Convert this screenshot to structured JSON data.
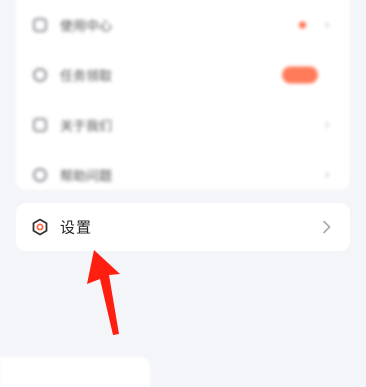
{
  "menu": {
    "items": [
      {
        "label": "使用中心",
        "icon": "grid-icon",
        "badge": "dot"
      },
      {
        "label": "任务领取",
        "icon": "gift-icon",
        "badge": "pill"
      },
      {
        "label": "关于我们",
        "icon": "info-icon",
        "badge": ""
      },
      {
        "label": "帮助问题",
        "icon": "help-icon",
        "badge": ""
      }
    ]
  },
  "settings": {
    "label": "设置",
    "icon": "hexagon-gear-icon"
  },
  "annotation": {
    "type": "red-arrow",
    "color": "#ff1f10"
  },
  "colors": {
    "accent": "#ff6a4a",
    "background": "#f4f5f9",
    "card": "#ffffff"
  }
}
